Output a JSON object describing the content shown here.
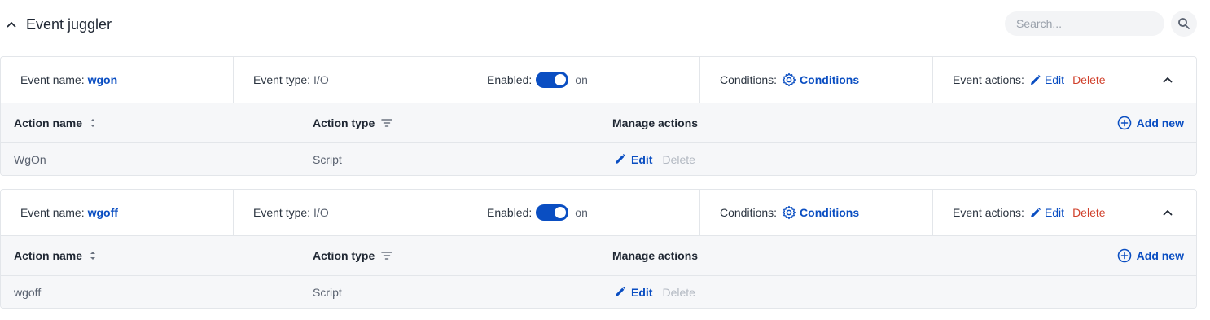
{
  "header": {
    "title": "Event juggler",
    "search_placeholder": "Search..."
  },
  "event_labels": {
    "name": "Event name:",
    "type": "Event type:",
    "enabled": "Enabled:",
    "conditions": "Conditions:",
    "actions": "Event actions:",
    "conditions_link": "Conditions",
    "edit": "Edit",
    "delete": "Delete"
  },
  "table_labels": {
    "action_name": "Action name",
    "action_type": "Action type",
    "manage_actions": "Manage actions",
    "add_new": "Add new",
    "edit": "Edit",
    "delete": "Delete"
  },
  "events": [
    {
      "name": "wgon",
      "type": "I/O",
      "enabled": true,
      "enabled_text": "on",
      "actions": [
        {
          "name": "WgOn",
          "type": "Script"
        }
      ]
    },
    {
      "name": "wgoff",
      "type": "I/O",
      "enabled": true,
      "enabled_text": "on",
      "actions": [
        {
          "name": "wgoff",
          "type": "Script"
        }
      ]
    }
  ],
  "colors": {
    "accent": "#0a4ec2",
    "danger": "#d0402b",
    "border": "#e3e6ea",
    "row_bg": "#f6f7f9"
  }
}
